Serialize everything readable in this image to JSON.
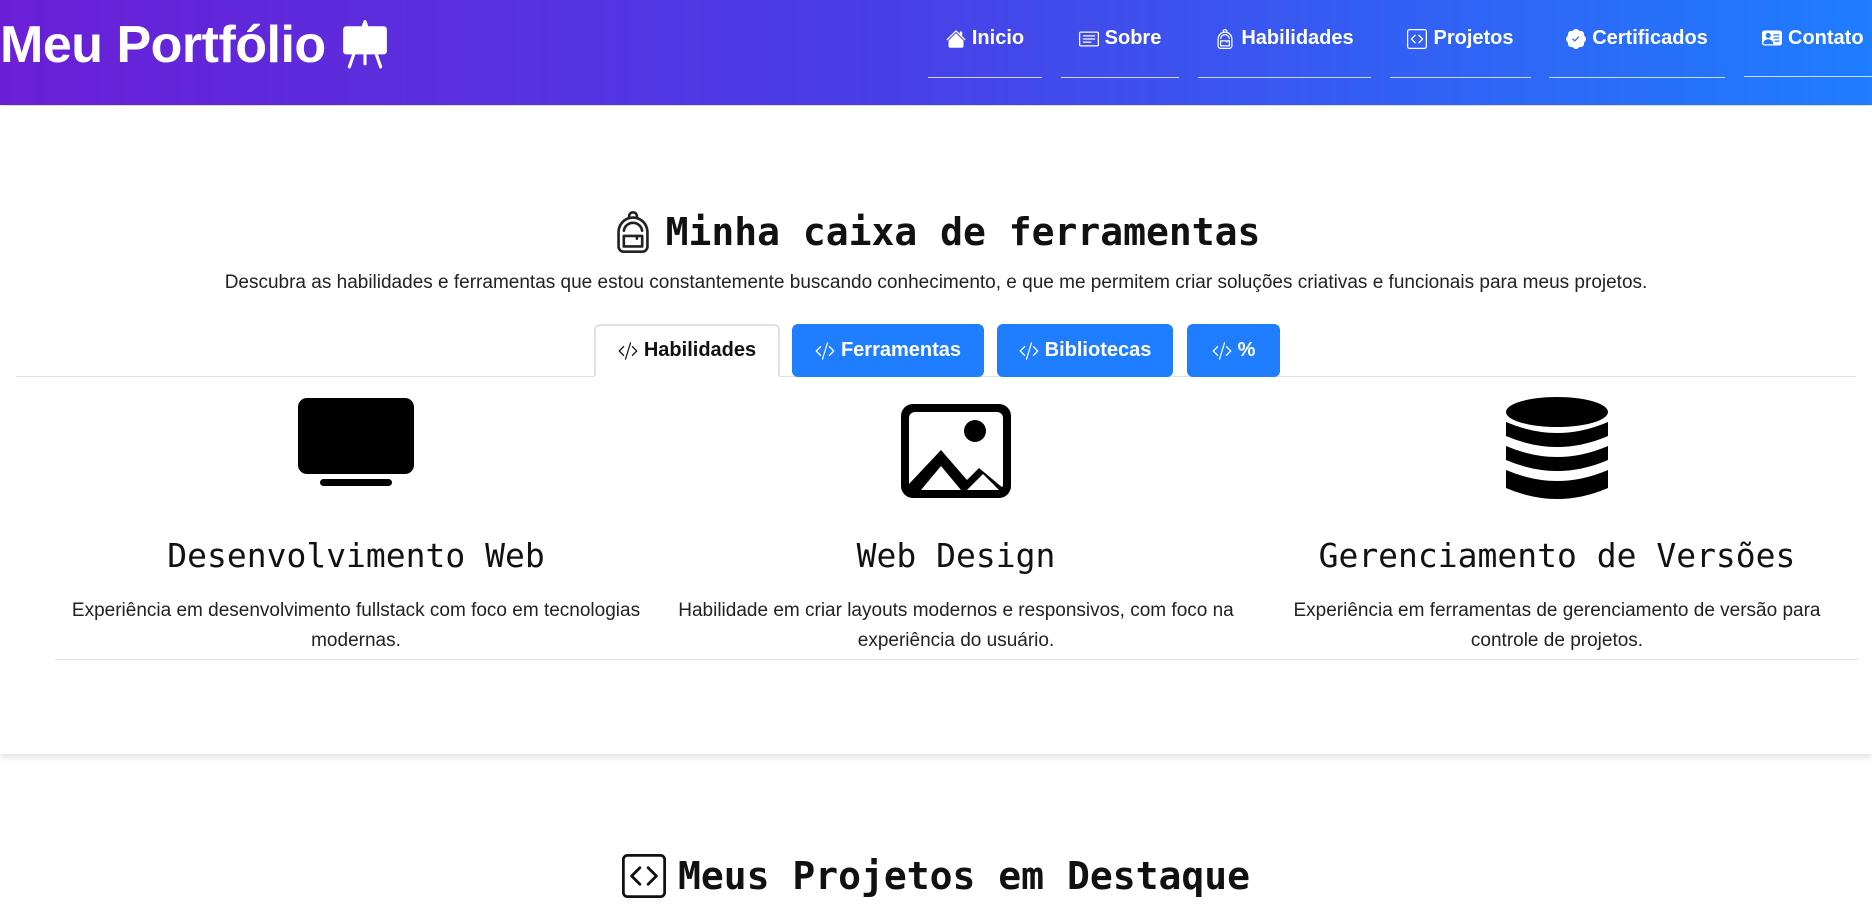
{
  "brand": {
    "title": "Meu Portfólio",
    "icon": "easel-icon"
  },
  "nav": [
    {
      "label": "Inicio",
      "icon": "house-icon"
    },
    {
      "label": "Sobre",
      "icon": "card-text-icon"
    },
    {
      "label": "Habilidades",
      "icon": "backpack-icon"
    },
    {
      "label": "Projetos",
      "icon": "code-square-icon"
    },
    {
      "label": "Certificados",
      "icon": "patch-check-icon"
    },
    {
      "label": "Contato",
      "icon": "person-vcard-icon"
    }
  ],
  "skills_section": {
    "title": "Minha caixa de ferramentas",
    "icon": "backpack-icon",
    "lead": "Descubra as habilidades e ferramentas que estou constantemente buscando conhecimento, e que me permitem criar soluções criativas e funcionais para meus projetos.",
    "tabs": [
      {
        "label": "Habilidades",
        "active": true
      },
      {
        "label": "Ferramentas",
        "active": false
      },
      {
        "label": "Bibliotecas",
        "active": false
      },
      {
        "label": "%",
        "active": false
      }
    ],
    "cards": [
      {
        "icon": "tv-icon",
        "title": "Desenvolvimento Web",
        "desc": "Experiência em desenvolvimento fullstack com foco em tecnologias modernas."
      },
      {
        "icon": "image-icon",
        "title": "Web Design",
        "desc": "Habilidade em criar layouts modernos e responsivos, com foco na experiência do usuário."
      },
      {
        "icon": "database-icon",
        "title": "Gerenciamento de Versões",
        "desc": "Experiência em ferramentas de gerenciamento de versão para controle de projetos."
      }
    ]
  },
  "projects_section": {
    "title": "Meus Projetos em Destaque",
    "icon": "code-square-icon"
  },
  "colors": {
    "nav_start": "#6a1fd6",
    "nav_end": "#1f7dff",
    "tab_button": "#1f7dff"
  }
}
